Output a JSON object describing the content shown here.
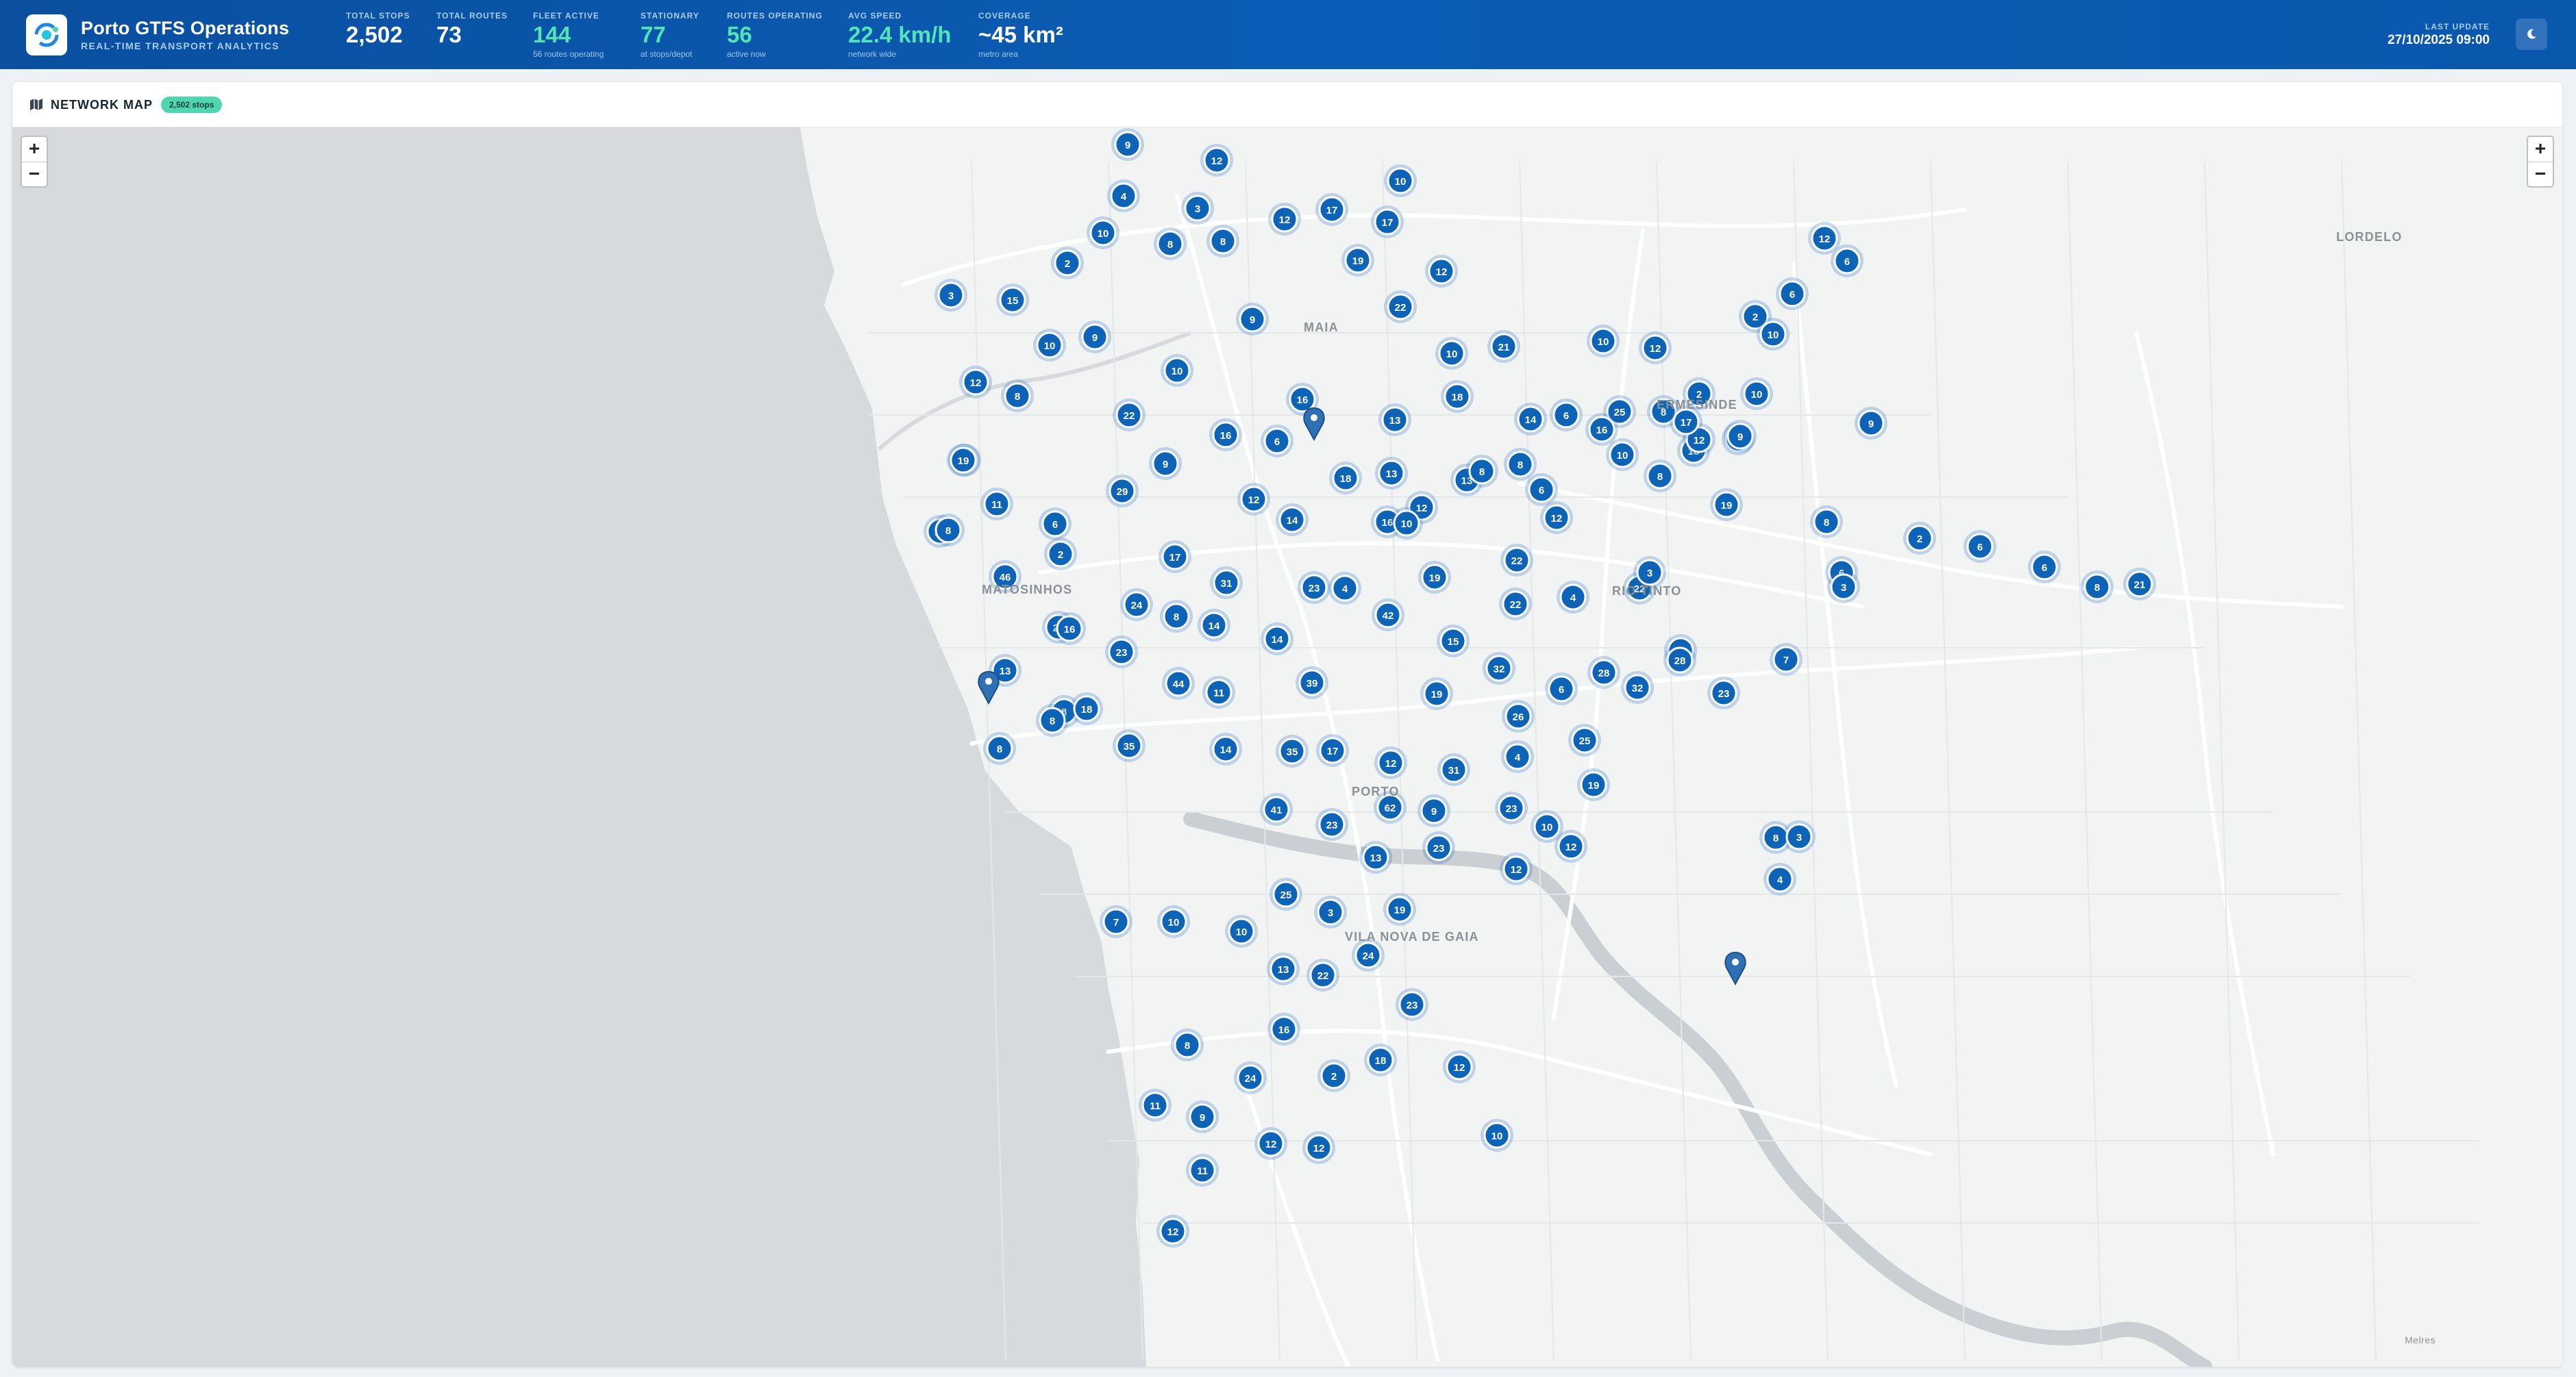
{
  "header": {
    "title": "Porto GTFS Operations",
    "subtitle": "REAL-TIME TRANSPORT ANALYTICS",
    "stats": [
      {
        "label": "TOTAL STOPS",
        "value": "2,502",
        "sub": "",
        "accent": false
      },
      {
        "label": "TOTAL ROUTES",
        "value": "73",
        "sub": "",
        "accent": false
      },
      {
        "label": "FLEET ACTIVE",
        "value": "144",
        "sub": "56 routes operating",
        "accent": true
      },
      {
        "label": "STATIONARY",
        "value": "77",
        "sub": "at stops/depot",
        "accent": true
      },
      {
        "label": "ROUTES OPERATING",
        "value": "56",
        "sub": "active now",
        "accent": true
      },
      {
        "label": "AVG SPEED",
        "value": "22.4 km/h",
        "sub": "network wide",
        "accent": true
      },
      {
        "label": "COVERAGE",
        "value": "~45 km²",
        "sub": "metro area",
        "accent": false
      }
    ],
    "last_update_label": "LAST UPDATE",
    "last_update_value": "27/10/2025 09:00",
    "theme_toggle_icon": "moon-icon"
  },
  "map_card": {
    "title": "NETWORK MAP",
    "icon": "map-icon",
    "badge": "2,502 stops"
  },
  "map": {
    "zoom_in_label": "+",
    "zoom_out_label": "−",
    "places": {
      "maia": "MAIA",
      "matosinhos": "MATOSINHOS",
      "porto": "PORTO",
      "vila_nova_de_gaia": "VILA NOVA DE GAIA",
      "rio_tinto": "RIO TINTO",
      "lordelo": "LORDELO",
      "ermesinde": "ERMESINDE",
      "melres": "Melres"
    },
    "cluster_counts": [
      9,
      12,
      4,
      3,
      12,
      17,
      10,
      17,
      2,
      8,
      8,
      19,
      12,
      22,
      10,
      9,
      3,
      15,
      10,
      9,
      12,
      8,
      10,
      16,
      6,
      10,
      21,
      10,
      12,
      2,
      6,
      19,
      22,
      16,
      13,
      18,
      14,
      25,
      8,
      19,
      29,
      9,
      12,
      14,
      16,
      12,
      18,
      13,
      13,
      8,
      2,
      11,
      6,
      16,
      6,
      2,
      17,
      31,
      23,
      4,
      22,
      19,
      22,
      4,
      22,
      46,
      24,
      8,
      14,
      42,
      26,
      23,
      14,
      15,
      32,
      6,
      33,
      23,
      13,
      44,
      11,
      39,
      8,
      19,
      26,
      35,
      14,
      35,
      17,
      12,
      31,
      4,
      25,
      19,
      28,
      32,
      41,
      23,
      62,
      9,
      23,
      10,
      23,
      13,
      8,
      4,
      25,
      3,
      19,
      7,
      10,
      10,
      24,
      13,
      22,
      23,
      16,
      8,
      24,
      2,
      18,
      12,
      11,
      9,
      12,
      12,
      10,
      11,
      12,
      16,
      8,
      6,
      8,
      3,
      8,
      18,
      3,
      28,
      18,
      21,
      10,
      19,
      8,
      3,
      9,
      7,
      2,
      6,
      6,
      8,
      21,
      9,
      12,
      16,
      6,
      10,
      12,
      6,
      8,
      17,
      10,
      12,
      8,
      10,
      12,
      12
    ]
  }
}
